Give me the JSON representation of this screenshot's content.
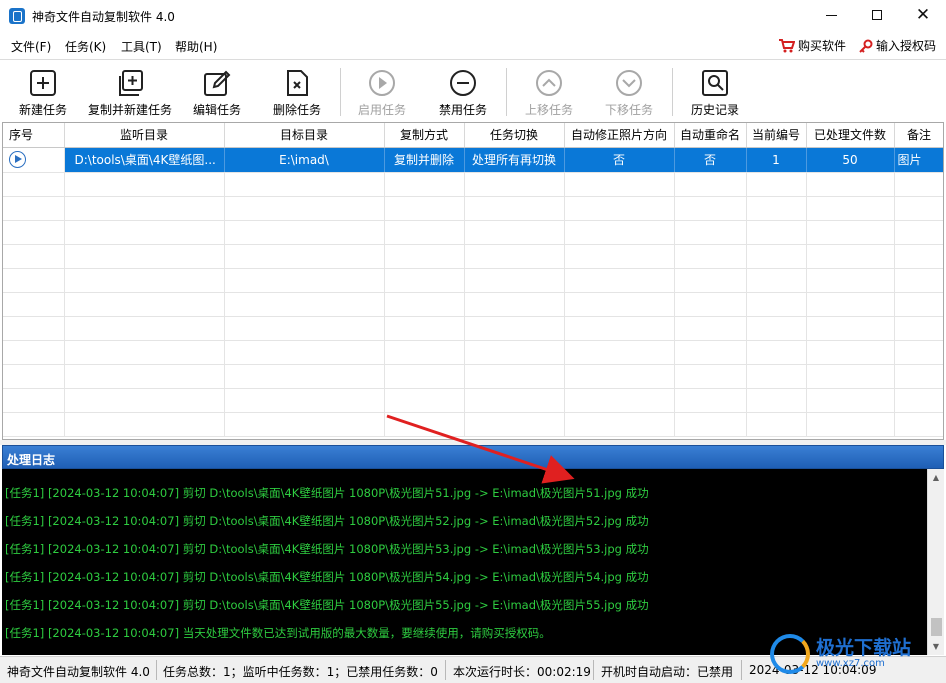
{
  "window": {
    "title": "神奇文件自动复制软件 4.0",
    "minimize": "—",
    "close": "✕"
  },
  "menu": {
    "items": [
      "文件(F)",
      "任务(K)",
      "工具(T)",
      "帮助(H)"
    ],
    "buy": "购买软件",
    "auth": "输入授权码"
  },
  "toolbar": {
    "new": "新建任务",
    "copy_new": "复制并新建任务",
    "edit": "编辑任务",
    "delete": "删除任务",
    "enable": "启用任务",
    "disable": "禁用任务",
    "move_up": "上移任务",
    "move_down": "下移任务",
    "history": "历史记录"
  },
  "grid": {
    "columns": [
      "序号",
      "监听目录",
      "目标目录",
      "复制方式",
      "任务切换",
      "自动修正照片方向",
      "自动重命名",
      "当前编号",
      "已处理文件数",
      "备注"
    ],
    "rows": [
      {
        "index": "1",
        "watch_dir": "D:\\tools\\桌面\\4K壁纸图...",
        "target_dir": "E:\\imad\\",
        "copy_mode": "复制并删除",
        "switch": "处理所有再切换",
        "fix_orientation": "否",
        "auto_rename": "否",
        "current_no": "1",
        "processed": "50",
        "note": "图片"
      }
    ]
  },
  "log": {
    "title": "处理日志",
    "lines": [
      "[任务1] [2024-03-12 10:04:07] 剪切 D:\\tools\\桌面\\4K壁纸图片 1080P\\极光图片51.jpg -> E:\\imad\\极光图片51.jpg 成功",
      "[任务1] [2024-03-12 10:04:07] 剪切 D:\\tools\\桌面\\4K壁纸图片 1080P\\极光图片52.jpg -> E:\\imad\\极光图片52.jpg 成功",
      "[任务1] [2024-03-12 10:04:07] 剪切 D:\\tools\\桌面\\4K壁纸图片 1080P\\极光图片53.jpg -> E:\\imad\\极光图片53.jpg 成功",
      "[任务1] [2024-03-12 10:04:07] 剪切 D:\\tools\\桌面\\4K壁纸图片 1080P\\极光图片54.jpg -> E:\\imad\\极光图片54.jpg 成功",
      "[任务1] [2024-03-12 10:04:07] 剪切 D:\\tools\\桌面\\4K壁纸图片 1080P\\极光图片55.jpg -> E:\\imad\\极光图片55.jpg 成功",
      "[任务1] [2024-03-12 10:04:07] 当天处理文件数已达到试用版的最大数量，要继续使用，请购买授权码。"
    ]
  },
  "status": {
    "app": "神奇文件自动复制软件 4.0",
    "counts": "任务总数：1；监听中任务数：1；已禁用任务数：0",
    "runtime": "本次运行时长：00:02:19",
    "autostart": "开机时自动启动：已禁用",
    "datetime": "2024-03-12 10:04:09"
  },
  "watermark": {
    "name": "极光下载站",
    "url": "www.xz7.com"
  },
  "colors": {
    "selection": "#0a78d7",
    "log_text": "#2ecc40",
    "log_header": "#2a6fc8",
    "arrow": "#e02020"
  }
}
